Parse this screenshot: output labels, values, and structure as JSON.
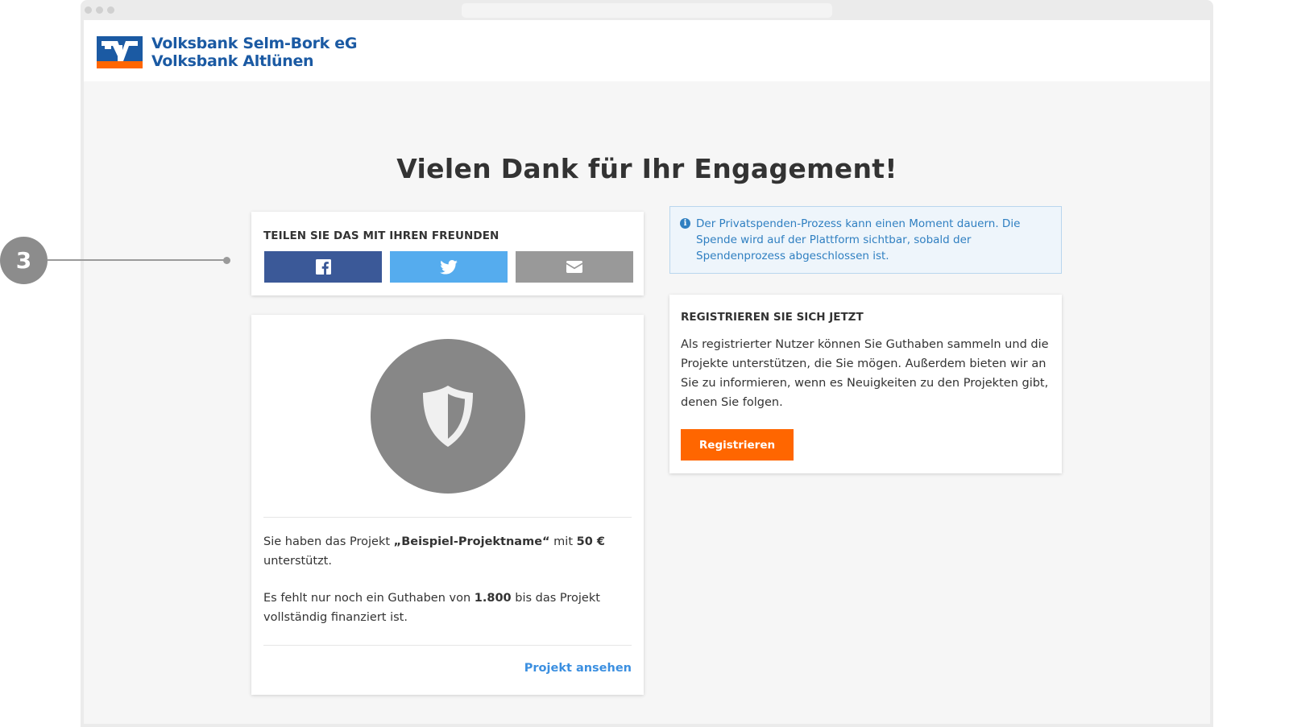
{
  "header": {
    "logo_line1": "Volksbank Selm-Bork eG",
    "logo_line2": "Volksbank Altlünen"
  },
  "page": {
    "title": "Vielen Dank für Ihr Engagement!"
  },
  "share": {
    "title": "TEILEN SIE DAS MIT IHREN FREUNDEN",
    "buttons": [
      {
        "name": "facebook",
        "icon": "facebook-icon",
        "color": "#3b5998"
      },
      {
        "name": "twitter",
        "icon": "twitter-icon",
        "color": "#55acee"
      },
      {
        "name": "email",
        "icon": "envelope-icon",
        "color": "#999999"
      }
    ]
  },
  "project": {
    "icon": "shield-icon",
    "text1_prefix": "Sie haben das Projekt ",
    "project_name": "„Beispiel-Projektname“",
    "text1_mid": " mit ",
    "amount": "50 €",
    "text1_suffix": " unterstützt.",
    "text2_prefix": "Es fehlt nur noch ein Guthaben von ",
    "remaining": "1.800",
    "text2_suffix": " bis das Projekt vollständig finanziert ist.",
    "link_label": "Projekt ansehen"
  },
  "info": {
    "icon": "info-icon",
    "icon_glyph": "i",
    "text": "Der Privatspenden-Prozess kann einen Moment dauern. Die Spende wird auf der Plattform sichtbar, sobald der Spendenprozess abgeschlossen ist."
  },
  "register": {
    "title": "REGISTRIEREN SIE SICH JETZT",
    "text": "Als registrierter Nutzer können Sie Guthaben sammeln und die Projekte unterstützen, die Sie mögen. Außerdem bieten wir an Sie zu informieren, wenn es Neuigkeiten zu den Projekten gibt, denen Sie folgen.",
    "button_label": "Registrieren"
  },
  "callout": {
    "number": "3"
  },
  "colors": {
    "brand_blue": "#1b5aa3",
    "brand_orange": "#ff6600",
    "link_blue": "#3b8fe0",
    "info_blue": "#2f7fc1"
  }
}
